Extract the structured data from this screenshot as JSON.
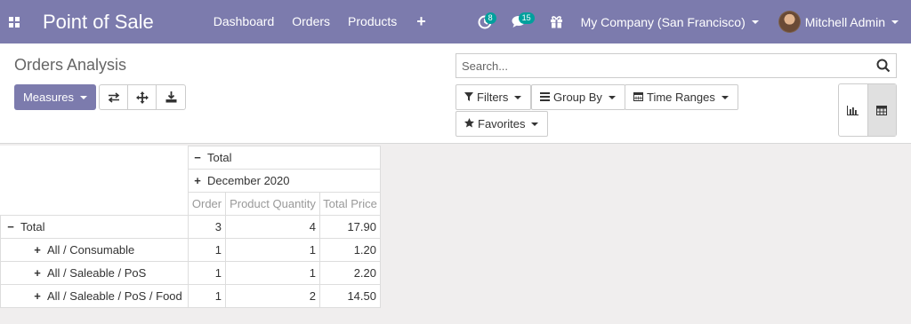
{
  "navbar": {
    "app_title": "Point of Sale",
    "menu": [
      "Dashboard",
      "Orders",
      "Products"
    ],
    "plus_label": "+",
    "activity_badge": "8",
    "messages_badge": "15",
    "company": "My Company (San Francisco)",
    "user": "Mitchell Admin",
    "accent_color": "#7c7bad",
    "badge_color": "#00a09d"
  },
  "control_panel": {
    "breadcrumb": "Orders Analysis",
    "measures_label": "Measures",
    "search_placeholder": "Search...",
    "filters_label": "Filters",
    "groupby_label": "Group By",
    "timeranges_label": "Time Ranges",
    "favorites_label": "Favorites"
  },
  "pivot": {
    "col_total_label": "Total",
    "col_group_label": "December 2020",
    "measures": [
      "Order",
      "Product Quantity",
      "Total Price"
    ],
    "rows": [
      {
        "label": "Total",
        "sign": "−",
        "order": "3",
        "qty": "4",
        "price": "17.90"
      },
      {
        "label": "All / Consumable",
        "sign": "+",
        "order": "1",
        "qty": "1",
        "price": "1.20"
      },
      {
        "label": "All / Saleable / PoS",
        "sign": "+",
        "order": "1",
        "qty": "1",
        "price": "2.20"
      },
      {
        "label": "All / Saleable / PoS / Food",
        "sign": "+",
        "order": "1",
        "qty": "2",
        "price": "14.50"
      }
    ]
  }
}
